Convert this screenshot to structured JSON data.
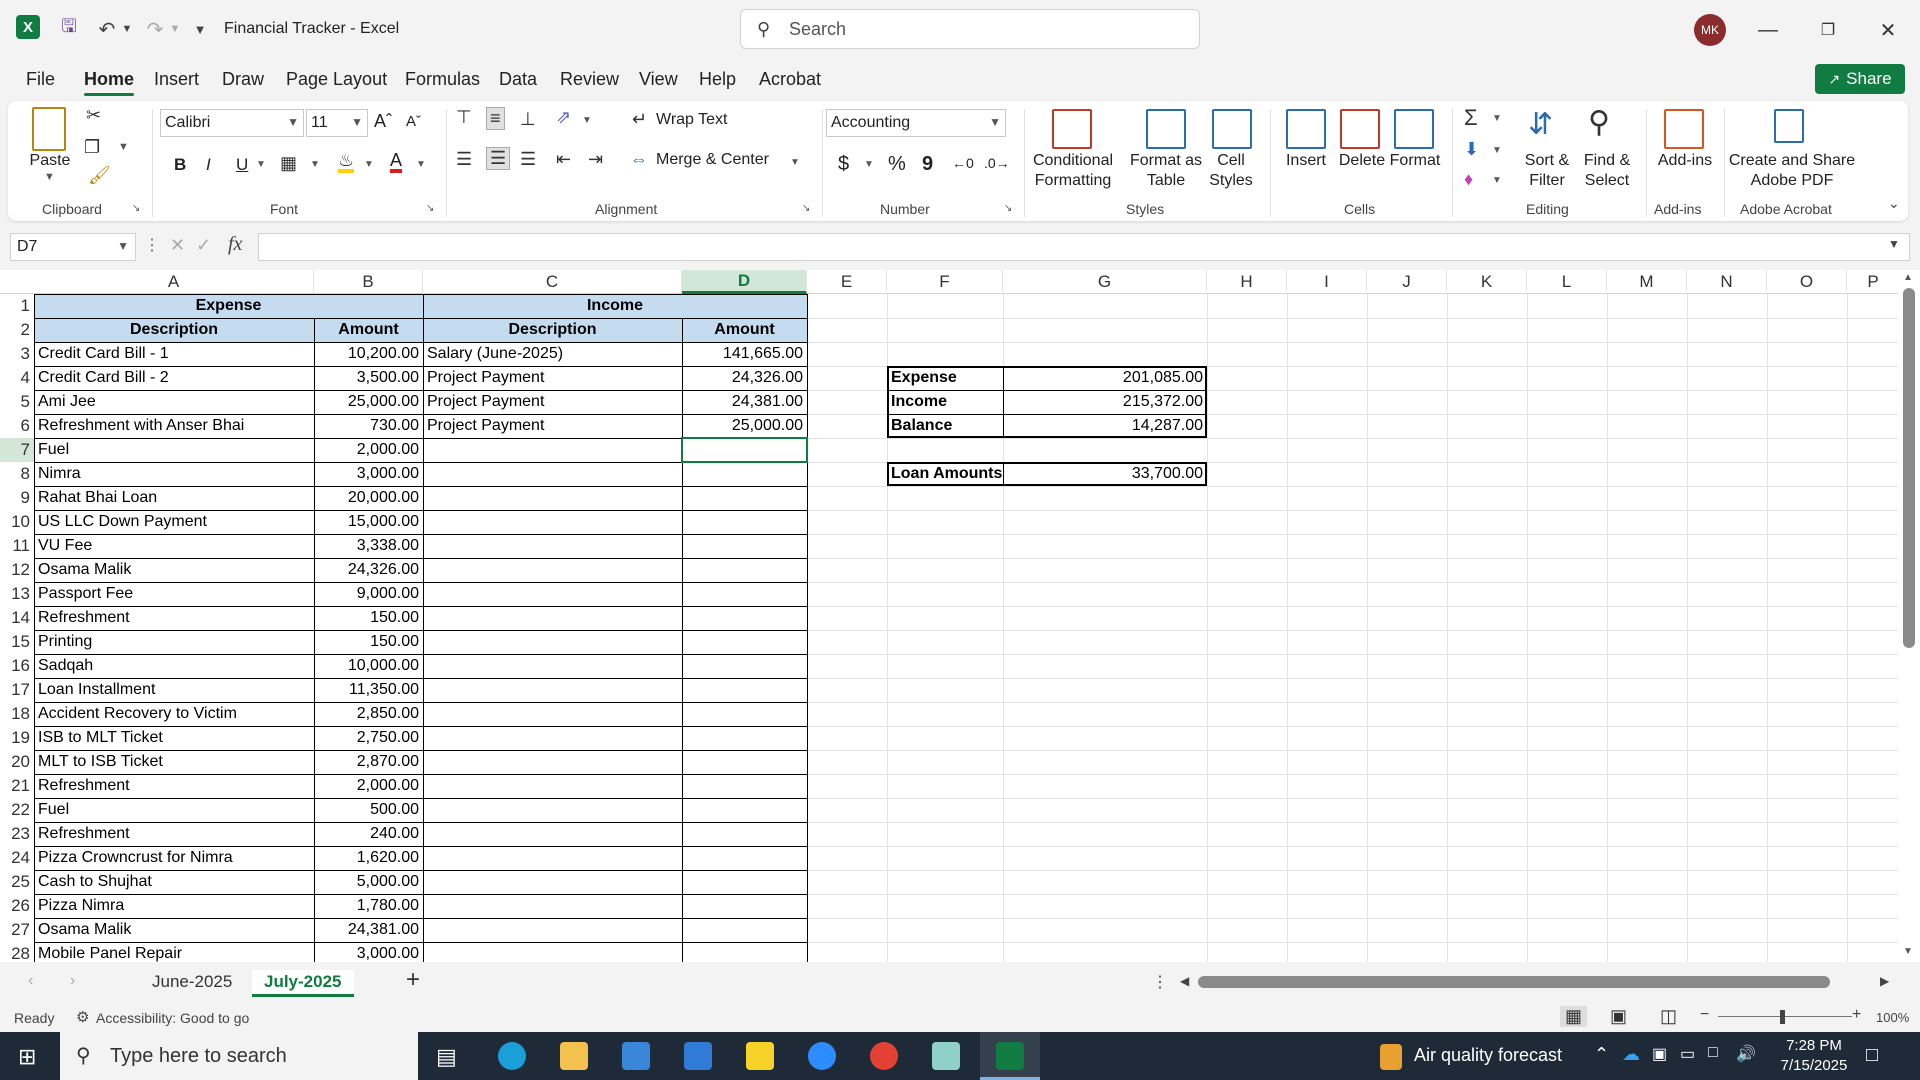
{
  "titlebar": {
    "title": "Financial Tracker  -  Excel",
    "search_placeholder": "Search",
    "avatar_initials": "MK"
  },
  "menu": {
    "tabs": [
      "File",
      "Home",
      "Insert",
      "Draw",
      "Page Layout",
      "Formulas",
      "Data",
      "Review",
      "View",
      "Help",
      "Acrobat"
    ],
    "active": "Home",
    "share_label": "Share"
  },
  "ribbon": {
    "clipboard": {
      "paste": "Paste",
      "group": "Clipboard"
    },
    "font": {
      "name": "Calibri",
      "size": "11",
      "group": "Font",
      "bold": "B",
      "italic": "I",
      "underline": "U"
    },
    "alignment": {
      "wrap": "Wrap Text",
      "merge": "Merge & Center",
      "group": "Alignment"
    },
    "number": {
      "format": "Accounting",
      "group": "Number",
      "currency": "$",
      "percent": "%",
      "comma": "9"
    },
    "styles": {
      "conditional1": "Conditional",
      "conditional2": "Formatting",
      "format_table1": "Format as",
      "format_table2": "Table",
      "cell_styles1": "Cell",
      "cell_styles2": "Styles",
      "group": "Styles"
    },
    "cells": {
      "insert": "Insert",
      "delete": "Delete",
      "format": "Format",
      "group": "Cells"
    },
    "editing": {
      "sort1": "Sort &",
      "sort2": "Filter",
      "find1": "Find &",
      "find2": "Select",
      "group": "Editing"
    },
    "addins": {
      "label": "Add-ins",
      "group": "Add-ins"
    },
    "acrobat": {
      "label1": "Create and Share",
      "label2": "Adobe PDF",
      "group": "Adobe Acrobat"
    }
  },
  "formula_bar": {
    "name_box": "D7",
    "fx": "fx",
    "formula": ""
  },
  "grid": {
    "columns": [
      "A",
      "B",
      "C",
      "D",
      "E",
      "F",
      "G",
      "H",
      "I",
      "J",
      "K",
      "L",
      "M",
      "N",
      "O",
      "P"
    ],
    "rows": [
      "1",
      "2",
      "3",
      "4",
      "5",
      "6",
      "7",
      "8",
      "9",
      "10",
      "11",
      "12",
      "13",
      "14",
      "15",
      "16",
      "17",
      "18",
      "19",
      "20",
      "21",
      "22",
      "23",
      "24",
      "25",
      "26",
      "27",
      "28"
    ],
    "expense_header": "Expense",
    "income_header": "Income",
    "sub_headers": [
      "Description",
      "Amount",
      "Description",
      "Amount"
    ],
    "expenses": [
      [
        "Credit Card Bill - 1",
        "10,200.00"
      ],
      [
        "Credit Card Bill - 2",
        "3,500.00"
      ],
      [
        "Ami Jee",
        "25,000.00"
      ],
      [
        "Refreshment with Anser Bhai",
        "730.00"
      ],
      [
        "Fuel",
        "2,000.00"
      ],
      [
        "Nimra",
        "3,000.00"
      ],
      [
        "Rahat Bhai Loan",
        "20,000.00"
      ],
      [
        "US LLC Down Payment",
        "15,000.00"
      ],
      [
        "VU Fee",
        "3,338.00"
      ],
      [
        "Osama Malik",
        "24,326.00"
      ],
      [
        "Passport Fee",
        "9,000.00"
      ],
      [
        "Refreshment",
        "150.00"
      ],
      [
        "Printing",
        "150.00"
      ],
      [
        "Sadqah",
        "10,000.00"
      ],
      [
        "Loan Installment",
        "11,350.00"
      ],
      [
        "Accident Recovery to Victim",
        "2,850.00"
      ],
      [
        "ISB to MLT Ticket",
        "2,750.00"
      ],
      [
        "MLT to ISB Ticket",
        "2,870.00"
      ],
      [
        "Refreshment",
        "2,000.00"
      ],
      [
        "Fuel",
        "500.00"
      ],
      [
        "Refreshment",
        "240.00"
      ],
      [
        "Pizza Crowncrust for Nimra",
        "1,620.00"
      ],
      [
        "Cash to Shujhat",
        "5,000.00"
      ],
      [
        "Pizza Nimra",
        "1,780.00"
      ],
      [
        "Osama Malik",
        "24,381.00"
      ],
      [
        "Mobile Panel Repair",
        "3,000.00"
      ]
    ],
    "income": [
      [
        "Salary (June-2025)",
        "141,665.00"
      ],
      [
        "Project Payment",
        "24,326.00"
      ],
      [
        "Project Payment",
        "24,381.00"
      ],
      [
        "Project Payment",
        "25,000.00"
      ]
    ],
    "summary": [
      [
        "Expense",
        "201,085.00"
      ],
      [
        "Income",
        "215,372.00"
      ],
      [
        "Balance",
        "14,287.00"
      ]
    ],
    "loan": [
      "Loan Amounts",
      "33,700.00"
    ]
  },
  "sheets": {
    "tabs": [
      "June-2025",
      "July-2025"
    ],
    "active": "July-2025",
    "add": "+"
  },
  "status": {
    "ready": "Ready",
    "accessibility": "Accessibility: Good to go",
    "zoom": "100%"
  },
  "taskbar": {
    "search_placeholder": "Type here to search",
    "weather": "Air quality forecast",
    "time": "7:28 PM",
    "date": "7/15/2025"
  },
  "colors": {
    "accent": "#107c41",
    "header_fill": "#c5dcf0",
    "taskbar": "#1f2a38"
  }
}
